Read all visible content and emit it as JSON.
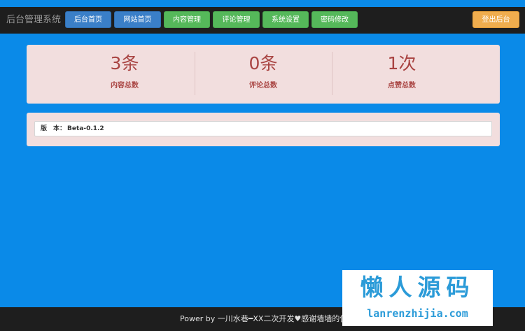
{
  "header": {
    "brand": "后台管理系统",
    "nav": [
      {
        "label": "后台首页",
        "color": "#3a7fc8"
      },
      {
        "label": "网站首页",
        "color": "#3a7fc8"
      },
      {
        "label": "内容管理",
        "color": "#55b85a"
      },
      {
        "label": "评论管理",
        "color": "#55b85a"
      },
      {
        "label": "系统设置",
        "color": "#55b85a"
      },
      {
        "label": "密码修改",
        "color": "#55b85a"
      }
    ],
    "logout_label": "登出后台"
  },
  "stats": [
    {
      "value": "3条",
      "label": "内容总数"
    },
    {
      "value": "0条",
      "label": "评论总数"
    },
    {
      "value": "1次",
      "label": "点赞总数"
    }
  ],
  "info": {
    "key": "版　本：",
    "value": "Beta-0.1.2"
  },
  "footer": {
    "text": "Power by 一川水巷━XX二次开发♥感谢墙墙的使用"
  },
  "watermark": {
    "title": "懒人源码",
    "url": "lanrenzhijia.com"
  },
  "colors": {
    "page_bg": "#0a8ae8",
    "bar_bg": "#1e1e1e",
    "panel_bg": "#f2dede",
    "stat_text": "#a94442",
    "watermark": "#2b9bd8"
  }
}
